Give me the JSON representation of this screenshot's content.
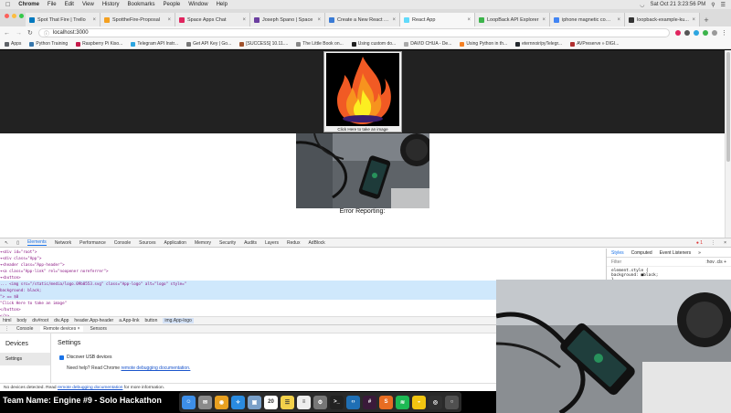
{
  "menubar": {
    "app": "Chrome",
    "items": [
      "File",
      "Edit",
      "View",
      "History",
      "Bookmarks",
      "People",
      "Window",
      "Help"
    ],
    "clock": "Sat Oct 21  3:23:56 PM"
  },
  "tabs": [
    {
      "title": "Spot That Fire | Trello",
      "color": "#0079bf",
      "active": false
    },
    {
      "title": "SpottheFire-Proposal",
      "color": "#f4a020",
      "active": false
    },
    {
      "title": "Space Apps Chat",
      "color": "#e0245e",
      "active": false
    },
    {
      "title": "Joseph Spano | Space",
      "color": "#6b3fa0",
      "active": false
    },
    {
      "title": "Create a New React A...",
      "color": "#3a7bd5",
      "active": false
    },
    {
      "title": "React App",
      "color": "#61dafb",
      "active": true
    },
    {
      "title": "LoopBack API Explorer",
      "color": "#3cb44b",
      "active": false
    },
    {
      "title": "iphone magnetic comp...",
      "color": "#4285f4",
      "active": false
    },
    {
      "title": "loopback-example-ku...",
      "color": "#333333",
      "active": false
    }
  ],
  "addressbar": {
    "url": "localhost:3000"
  },
  "bookmarks": [
    {
      "label": "Apps",
      "color": "#5f6368"
    },
    {
      "label": "Python Training",
      "color": "#3776ab"
    },
    {
      "label": "Raspberry Pi Kiso...",
      "color": "#c51a4a"
    },
    {
      "label": "Telegram API Instr...",
      "color": "#2ca5e0"
    },
    {
      "label": "Get API Key  |  Go...",
      "color": "#777777"
    },
    {
      "label": "[SUCCESS] 10.11....",
      "color": "#a0522d"
    },
    {
      "label": "The Little Book on...",
      "color": "#888888"
    },
    {
      "label": "Using custom do...",
      "color": "#222222"
    },
    {
      "label": "DAVID CHUA - De...",
      "color": "#aaaaaa"
    },
    {
      "label": "Using Python in th...",
      "color": "#f48024"
    },
    {
      "label": "eternnoir/pyTelegr...",
      "color": "#24292e"
    },
    {
      "label": "AVPreserve » DIGI...",
      "color": "#b03030"
    }
  ],
  "page": {
    "logo_caption": "Click Here to take an image",
    "error_label": "Error Reporting:"
  },
  "devtools": {
    "tabs": [
      "Elements",
      "Network",
      "Performance",
      "Console",
      "Sources",
      "Application",
      "Memory",
      "Security",
      "Audits",
      "Layers",
      "Redux",
      "AdBlock"
    ],
    "selected_tab": "Elements",
    "issues": "1",
    "elements": [
      {
        "text": "▾<div id=\"root\">",
        "hl": false
      },
      {
        "text": "  ▾<div class=\"App\">",
        "hl": false
      },
      {
        "text": "    ▾<header class=\"App-header\">",
        "hl": false
      },
      {
        "text": "      ▾<a class=\"App-link\" rel=\"noopener noreferrer\">",
        "hl": false
      },
      {
        "text": "        ▾<button>",
        "hl": false
      },
      {
        "text": "...         <img src=\"/static/media/logo.09b0553.svg\" class=\"App-logo\" alt=\"logo\" style=\"",
        "hl": true
      },
      {
        "text": "              background: black;",
        "hl": true
      },
      {
        "text": "            \"> == $0",
        "hl": true
      },
      {
        "text": "            \"Click Here to take an image\"",
        "hl": false
      },
      {
        "text": "          </button>",
        "hl": false
      },
      {
        "text": "        </a>",
        "hl": false
      }
    ],
    "styles_tabs": [
      "Styles",
      "Computed",
      "Event Listeners",
      "»"
    ],
    "filter_placeholder": "Filter",
    "filter_right": ":hov  .cls  +",
    "style_rule_selector": "element.style {",
    "style_rule_decl": "  background: ■black;",
    "style_rule_end": "}",
    "breadcrumbs": [
      "html",
      "body",
      "div#root",
      "div.App",
      "header.App-header",
      "a.App-link",
      "button",
      "img.App-logo"
    ],
    "drawer_tabs": [
      "Console",
      "Remote devices ×",
      "Sensors"
    ],
    "devices_title": "Devices",
    "settings_item": "Settings",
    "settings_title": "Settings",
    "discover_usb": "Discover USB devices",
    "help_prefix": "Need help? Read Chrome",
    "help_link": "remote debugging documentation.",
    "status_prefix": "No devices detected. Read",
    "status_link": "remote debugging documentation",
    "status_suffix": "for more information."
  },
  "overlay": {
    "team_name": "Team Name: Engine #9 - Solo Hackathon"
  },
  "dock": [
    {
      "name": "finder",
      "color": "#3d8ee8",
      "glyph": "☺"
    },
    {
      "name": "launchpad",
      "color": "#8a8a8a",
      "glyph": "✉"
    },
    {
      "name": "chrome",
      "color": "#e8a020",
      "glyph": "◉"
    },
    {
      "name": "safari",
      "color": "#2a8be0",
      "glyph": "✧"
    },
    {
      "name": "preview",
      "color": "#7aa0c8",
      "glyph": "▣"
    },
    {
      "name": "calendar",
      "color": "#ffffff",
      "glyph": "20"
    },
    {
      "name": "notes",
      "color": "#f3d14b",
      "glyph": "☰"
    },
    {
      "name": "reminders",
      "color": "#eeeeee",
      "glyph": "≡"
    },
    {
      "name": "system-prefs",
      "color": "#777777",
      "glyph": "⚙"
    },
    {
      "name": "terminal",
      "color": "#222222",
      "glyph": ">_"
    },
    {
      "name": "vscode",
      "color": "#1f6fb5",
      "glyph": "‹›"
    },
    {
      "name": "slack",
      "color": "#3a1a3a",
      "glyph": "#"
    },
    {
      "name": "sublime",
      "color": "#e86d22",
      "glyph": "S"
    },
    {
      "name": "spotify",
      "color": "#1db954",
      "glyph": "≋"
    },
    {
      "name": "cyberduck",
      "color": "#f2c511",
      "glyph": "◒"
    },
    {
      "name": "obs",
      "color": "#303030",
      "glyph": "◎"
    },
    {
      "name": "obs-2",
      "color": "#505050",
      "glyph": "○"
    }
  ]
}
